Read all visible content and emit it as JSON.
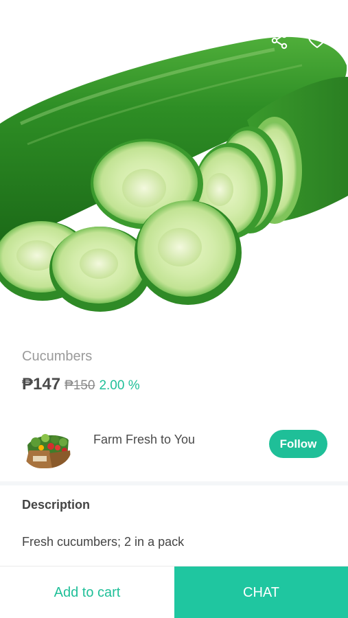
{
  "product": {
    "name": "Cucumbers",
    "price": "₱147",
    "old_price": "₱150",
    "discount": "2.00 %"
  },
  "seller": {
    "name": "Farm Fresh to You",
    "follow_label": "Follow"
  },
  "description": {
    "title": "Description",
    "text": "Fresh cucumbers; 2 in a pack"
  },
  "actions": {
    "add_to_cart_label": "Add to cart",
    "chat_label": "CHAT"
  },
  "icons": {
    "back": "chevron-left-icon",
    "share": "share-icon",
    "favorite": "heart-outline-icon"
  },
  "colors": {
    "accent": "#1fbf98",
    "chat_bg": "#1fc6a0",
    "text_dark": "#4a4a4a",
    "text_muted": "#9a9a9a"
  }
}
